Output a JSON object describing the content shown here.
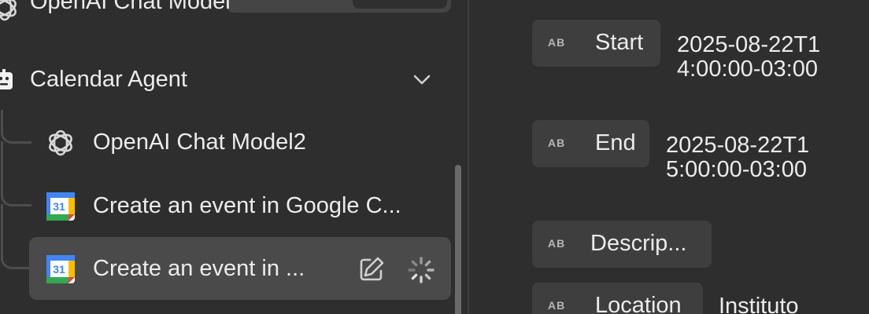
{
  "tree": {
    "top_item": {
      "label": "OpenAI Chat Model"
    },
    "agent": {
      "label": "Calendar Agent"
    },
    "children": [
      {
        "label": "OpenAI Chat Model2",
        "icon": "openai-icon"
      },
      {
        "label": "Create an event in Google C...",
        "icon": "google-calendar-icon",
        "calendar_day": "31"
      },
      {
        "label": "Create an event in ...",
        "icon": "google-calendar-icon",
        "calendar_day": "31",
        "selected": true
      }
    ]
  },
  "fields": {
    "type_badge": "AB",
    "start": {
      "label": "Start",
      "value": "2025-08-22T14:00:00-03:00"
    },
    "end": {
      "label": "End",
      "value": "2025-08-22T15:00:00-03:00"
    },
    "description": {
      "label": "Descrip..."
    },
    "location": {
      "label": "Location",
      "value": "Instituto"
    }
  },
  "colors": {
    "background": "#2e2e2e",
    "selected_row": "#4a4a4a",
    "chip": "#3e3e3e",
    "text": "#ececec",
    "gcal_blue": "#4285f4",
    "gcal_green": "#34a853",
    "gcal_yellow": "#fbbc04",
    "gcal_red": "#ea4335"
  }
}
